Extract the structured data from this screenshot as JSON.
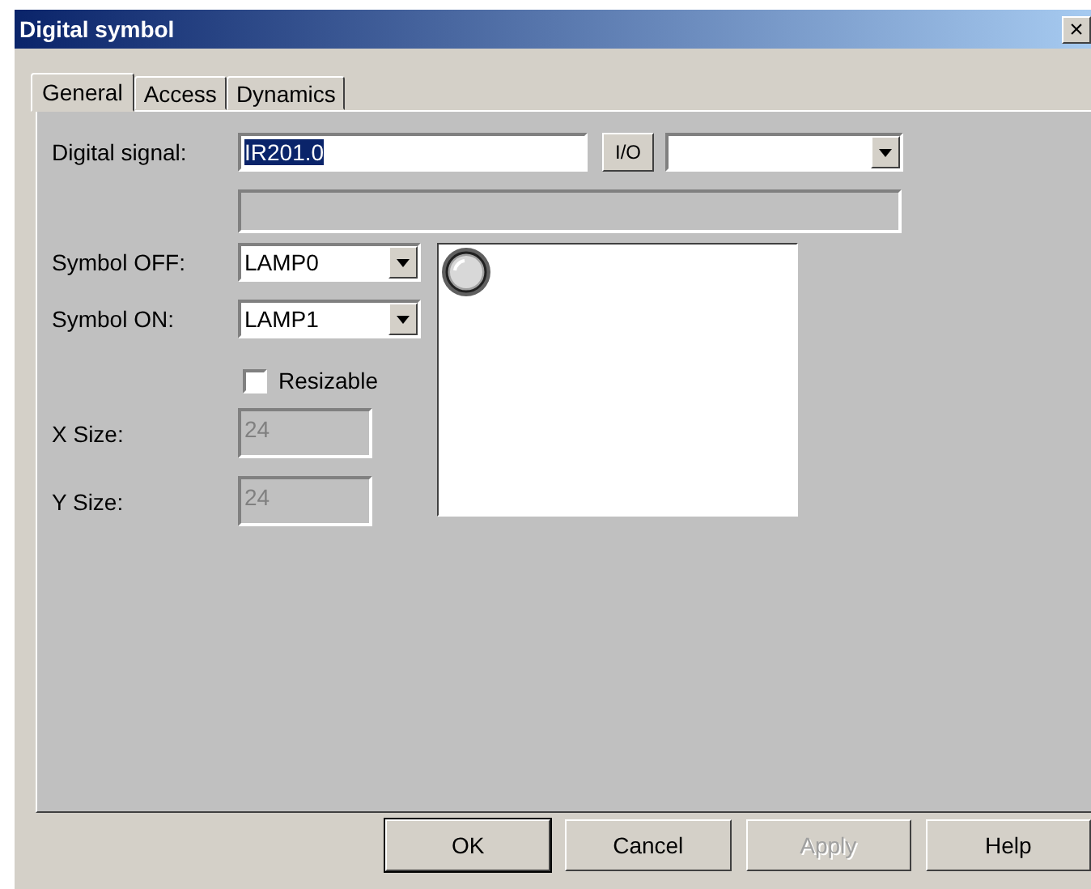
{
  "window": {
    "title": "Digital symbol",
    "close": "×"
  },
  "tabs": [
    {
      "label": "General",
      "selected": true
    },
    {
      "label": "Access",
      "selected": false
    },
    {
      "label": "Dynamics",
      "selected": false
    }
  ],
  "digital_signal": {
    "label": "Digital signal:",
    "value": "IR201.0",
    "value_selected": true,
    "io_button": "I/O"
  },
  "signal_description": {
    "disabled": true
  },
  "symbol_off": {
    "label": "Symbol OFF:",
    "value": "LAMP0"
  },
  "symbol_on": {
    "label": "Symbol ON:",
    "value": "LAMP1"
  },
  "resizable": {
    "label": "Resizable",
    "checked": false
  },
  "x_size": {
    "label": "X Size:",
    "value": "24",
    "disabled": true
  },
  "y_size": {
    "label": "Y Size:",
    "value": "24",
    "disabled": true
  },
  "buttons": [
    {
      "label": "OK",
      "default": true,
      "disabled": false
    },
    {
      "label": "Cancel",
      "default": false,
      "disabled": false
    },
    {
      "label": "Apply",
      "default": false,
      "disabled": true
    },
    {
      "label": "Help",
      "default": false,
      "disabled": false
    }
  ]
}
